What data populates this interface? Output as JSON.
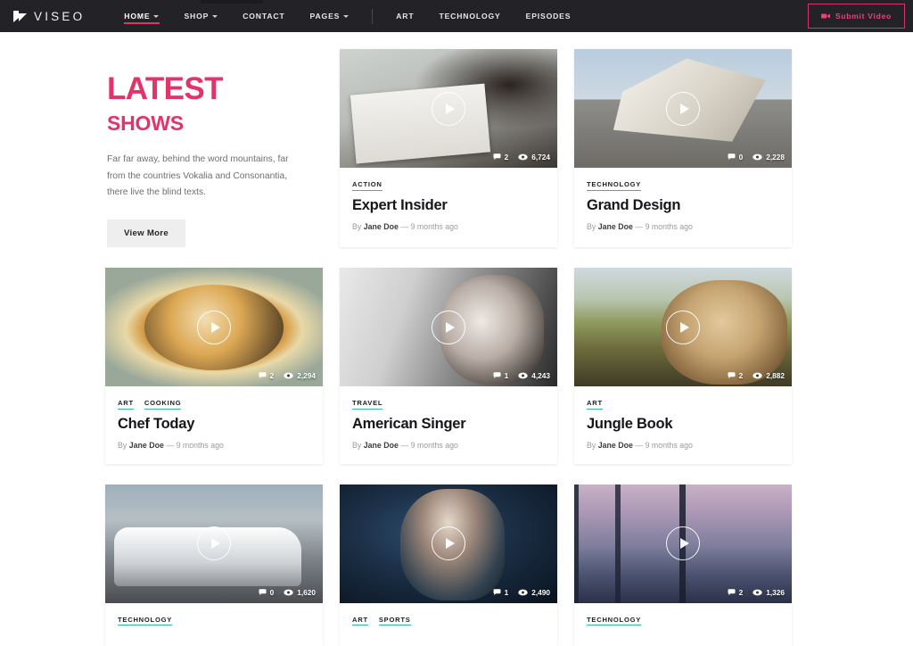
{
  "brand": {
    "name": "VISEO",
    "mark_icon": "viseo-flag-logo-icon"
  },
  "nav": {
    "items": [
      {
        "label": "HOME",
        "has_caret": true,
        "active": true
      },
      {
        "label": "SHOP",
        "has_caret": true,
        "active": false
      },
      {
        "label": "CONTACT",
        "has_caret": false,
        "active": false
      },
      {
        "label": "PAGES",
        "has_caret": true,
        "active": false
      }
    ],
    "secondary": [
      {
        "label": "ART"
      },
      {
        "label": "TECHNOLOGY"
      },
      {
        "label": "EPISODES"
      }
    ],
    "submit": {
      "label": "Submit Video",
      "icon": "video-camera-icon",
      "color": "#e94378"
    }
  },
  "intro": {
    "title": "LATEST",
    "subtitle": "SHOWS",
    "body": "Far far away, behind the word mountains, far from the countries Vokalia and Consonantia, there live the blind texts.",
    "button_label": "View More",
    "accent_color": "#e4326a"
  },
  "cards": [
    {
      "title": "Expert Insider",
      "categories": [
        "ACTION"
      ],
      "author": "Jane Doe",
      "date": "9 months ago",
      "comments": "2",
      "views": "6,724",
      "thumb_class": "img-business",
      "thumb_name": "thumbnail-business-newspaper"
    },
    {
      "title": "Grand Design",
      "categories": [
        "TECHNOLOGY"
      ],
      "author": "Jane Doe",
      "date": "9 months ago",
      "comments": "0",
      "views": "2,228",
      "thumb_class": "img-paper",
      "thumb_name": "thumbnail-architecture-paper"
    },
    {
      "title": "Chef Today",
      "categories": [
        "ART",
        "COOKING"
      ],
      "author": "Jane Doe",
      "date": "9 months ago",
      "comments": "2",
      "views": "2,294",
      "thumb_class": "img-food",
      "thumb_name": "thumbnail-food-skillet"
    },
    {
      "title": "American Singer",
      "categories": [
        "TRAVEL"
      ],
      "author": "Jane Doe",
      "date": "9 months ago",
      "comments": "1",
      "views": "4,243",
      "thumb_class": "img-singer",
      "thumb_name": "thumbnail-singer-microphone"
    },
    {
      "title": "Jungle Book",
      "categories": [
        "ART"
      ],
      "author": "Jane Doe",
      "date": "9 months ago",
      "comments": "2",
      "views": "2,882",
      "thumb_class": "img-lion",
      "thumb_name": "thumbnail-lioness"
    },
    {
      "title": "",
      "categories": [
        "TECHNOLOGY"
      ],
      "author": "",
      "date": "",
      "comments": "0",
      "views": "1,620",
      "thumb_class": "img-police",
      "thumb_name": "thumbnail-police-car"
    },
    {
      "title": "",
      "categories": [
        "ART",
        "SPORTS"
      ],
      "author": "",
      "date": "",
      "comments": "1",
      "views": "2,490",
      "thumb_class": "img-action",
      "thumb_name": "thumbnail-action-figure"
    },
    {
      "title": "",
      "categories": [
        "TECHNOLOGY"
      ],
      "author": "",
      "date": "",
      "comments": "2",
      "views": "1,326",
      "thumb_class": "img-forest",
      "thumb_name": "thumbnail-misty-forest"
    }
  ],
  "byline_separator": "—",
  "byline_prefix": "By",
  "icons": {
    "comment": "comment-bubble-icon",
    "views": "eye-icon",
    "play": "play-circle-icon"
  }
}
